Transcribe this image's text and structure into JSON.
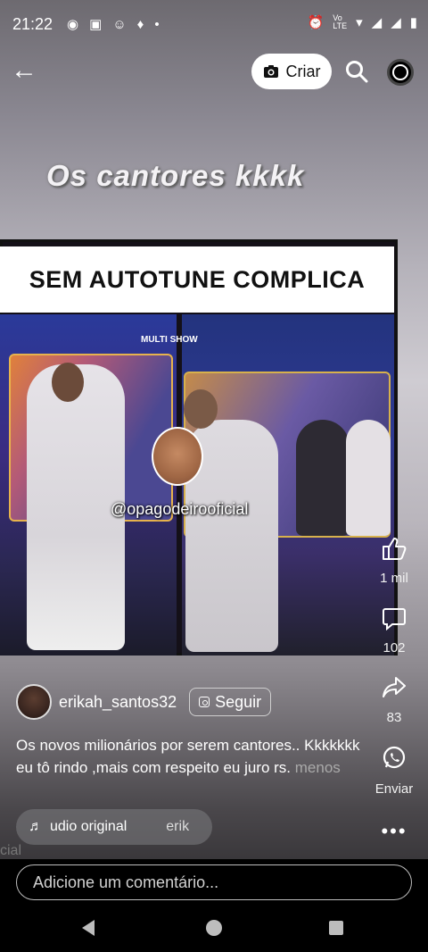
{
  "status_bar": {
    "time": "21:22",
    "left_icons": [
      "record-icon",
      "s-app-icon",
      "game-icon",
      "bell-icon",
      "dot-icon"
    ],
    "right_icons": [
      "alarm-icon",
      "volte-icon",
      "wifi-icon",
      "signal-4g-icon",
      "signal-icon",
      "battery-icon"
    ]
  },
  "top_bar": {
    "create_label": "Criar"
  },
  "video": {
    "overlay_caption": "Os cantores kkkk",
    "banner_text": "SEM AUTOTUNE COMPLICA",
    "watermark": "@opagodeirooficial",
    "logo_text": "MULTI SHOW"
  },
  "actions": {
    "likes": "1 mil",
    "comments": "102",
    "shares": "83",
    "send_label": "Enviar"
  },
  "post": {
    "username": "erikah_santos32",
    "follow_label": "Seguir",
    "caption": "Os novos milionários por serem cantores.. Kkkkkkk eu tô rindo ,mais com respeito eu juro rs.",
    "less_label": "menos",
    "audio_label": "udio original",
    "audio_author": "erik",
    "ghost_text": "cial"
  },
  "comment": {
    "placeholder": "Adicione um comentário..."
  },
  "colors": {
    "banner_bg": "#ffffff",
    "frame_border": "#e7b34d",
    "background_top": "#6d6a70",
    "background_mid": "#cfccd2"
  }
}
